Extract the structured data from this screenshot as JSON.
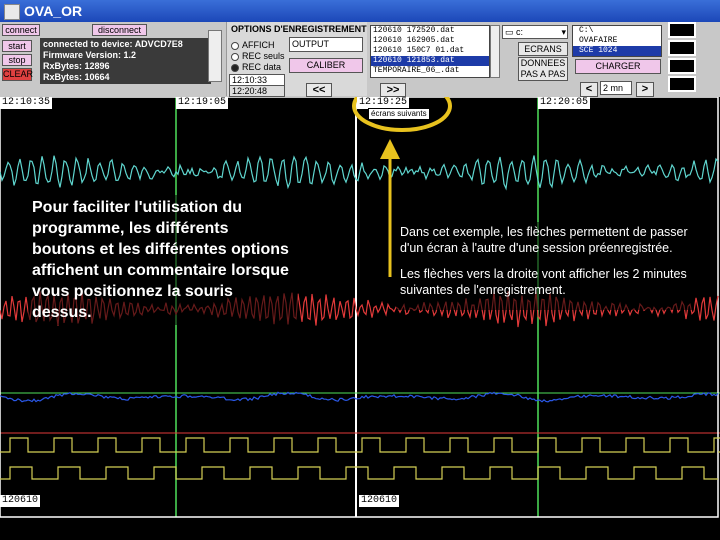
{
  "titlebar": {
    "title": "OVA_OR"
  },
  "control": {
    "connect_label": "connect",
    "disconnect_label": "disconnect",
    "start_label": "start",
    "stop_label": "stop",
    "clear_label": "CLEAR",
    "status_lines": [
      "connected to device: ADVCD7E8",
      "Firmware Version: 1.2",
      "RxBytes: 12896",
      "RxBytes: 10664"
    ]
  },
  "recording": {
    "title": "OPTIONS D'ENREGISTREMENT",
    "options": [
      "AFFICH",
      "REC seuls",
      "REC data"
    ],
    "filename_value": "OUTPUT",
    "calibrate_label": "CALIBER",
    "time_value": "12:10:33",
    "time_value2": "12:20:48"
  },
  "sessions": {
    "items": [
      "120610 172520.dat",
      "120610 162905.dat",
      "120610 150C7 01.dat",
      "120610 121853.dat",
      "TEMPORAIRE_06_.dat"
    ],
    "selected_index": 3
  },
  "drive": {
    "value": "c:"
  },
  "folders": {
    "items": [
      "C:\\",
      "OVAFAIRE",
      "SCE 1024"
    ],
    "selected_index": 2
  },
  "actions": {
    "ecrans_label": "ECRANS",
    "donnees_label": "DONNEES PAS A PAS",
    "charger_label": "CHARGER"
  },
  "nav": {
    "prev_session": "<<",
    "next_session": ">>",
    "prev_screen": "<",
    "next_screen": ">",
    "duration_value": "2 mn",
    "tooltip": "écrans suivants"
  },
  "chart": {
    "time_labels": [
      "12:10:35",
      "12:19:05",
      "12:19:25",
      "12:20:05"
    ],
    "bottom_labels": [
      "120610",
      "120610"
    ],
    "colors": {
      "cyan": "#5fd6cf",
      "red": "#e23a3a",
      "blue": "#2a58e8",
      "yellow": "#d4cf55",
      "grid_green": "#4fe05a",
      "grid_white": "#ffffff"
    }
  },
  "annotations": {
    "left": "Pour faciliter l'utilisation du programme, les différents boutons et les différentes options affichent un commentaire lorsque vous positionnez la souris dessus.",
    "right_1": "Dans cet exemple, les flèches permettent de passer d'un écran à l'autre d'une session préenregistrée.",
    "right_2": "Les flèches vers la droite vont afficher les 2 minutes suivantes de l'enregistrement.",
    "highlight_color": "#e8c21e"
  }
}
